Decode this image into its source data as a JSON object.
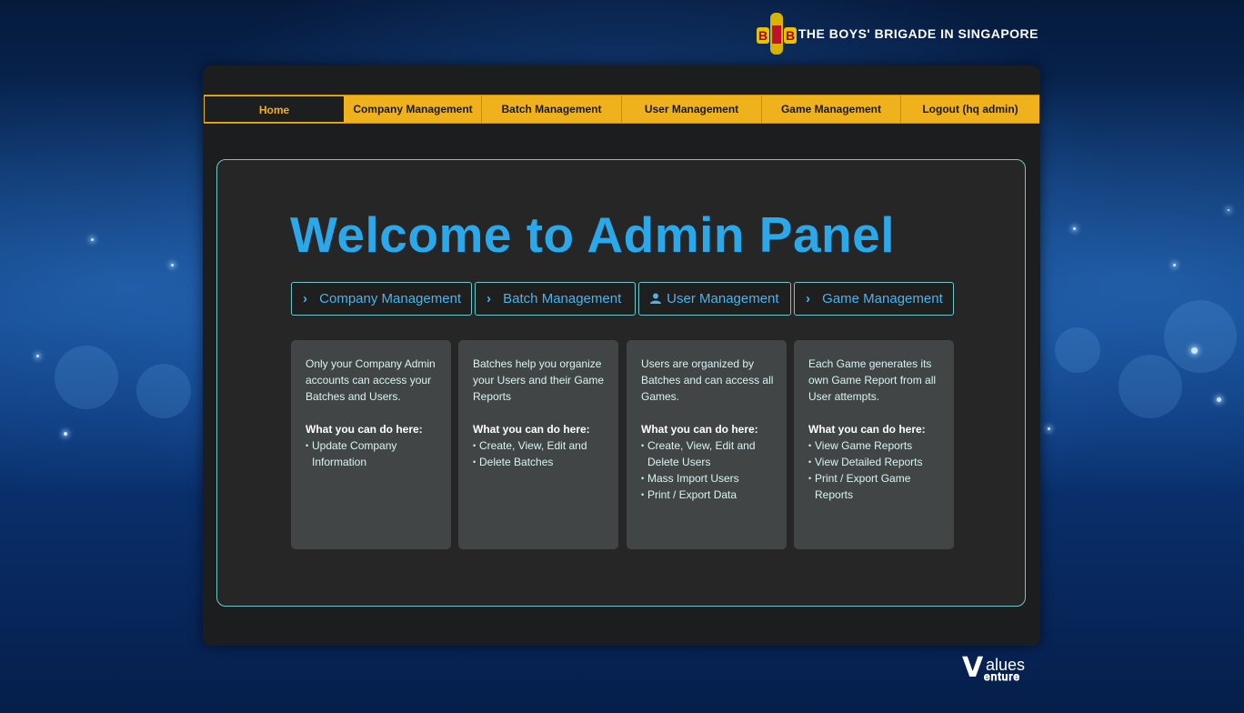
{
  "header": {
    "logo_title": "THE BOYS' BRIGADE IN SINGAPORE",
    "emblem_letters": [
      "B",
      "B"
    ]
  },
  "nav": {
    "items": [
      {
        "label": "Home",
        "active": true
      },
      {
        "label": "Company Management",
        "active": false
      },
      {
        "label": "Batch Management",
        "active": false
      },
      {
        "label": "User Management",
        "active": false
      },
      {
        "label": "Game Management",
        "active": false
      },
      {
        "label": "Logout (hq admin)",
        "active": false
      }
    ]
  },
  "main": {
    "heading": "Welcome to Admin Panel",
    "quick_buttons": [
      {
        "label": "Company Management",
        "icon": "chevron-right-icon"
      },
      {
        "label": "Batch Management",
        "icon": "chevron-right-icon"
      },
      {
        "label": "User Management",
        "icon": "user-icon"
      },
      {
        "label": "Game Management",
        "icon": "chevron-right-icon"
      }
    ],
    "cards": [
      {
        "description": "Only your Company Admin accounts can access your Batches and Users.",
        "what_label": "What you can do here:",
        "items": [
          "Update Company Information"
        ]
      },
      {
        "description": "Batches help you organize your Users and their Game Reports",
        "what_label": "What you can do here:",
        "items": [
          "Create, View, Edit and",
          "Delete Batches"
        ]
      },
      {
        "description": "Users are organized by Batches and can access all Games.",
        "what_label": "What you can do here:",
        "items": [
          "Create, View, Edit and Delete Users",
          "Mass Import Users",
          "Print / Export Data"
        ]
      },
      {
        "description": "Each Game generates its own Game Report from all User attempts.",
        "what_label": "What you can do here:",
        "items": [
          "View Game Reports",
          "View Detailed Reports",
          "Print / Export Game Reports"
        ]
      }
    ]
  },
  "footer": {
    "logo_top": "alues",
    "logo_bottom": "enture",
    "logo_mark": "V"
  },
  "colors": {
    "accent": "#f0b21c",
    "heading": "#2aa8ea",
    "border": "#6fc7c9"
  }
}
